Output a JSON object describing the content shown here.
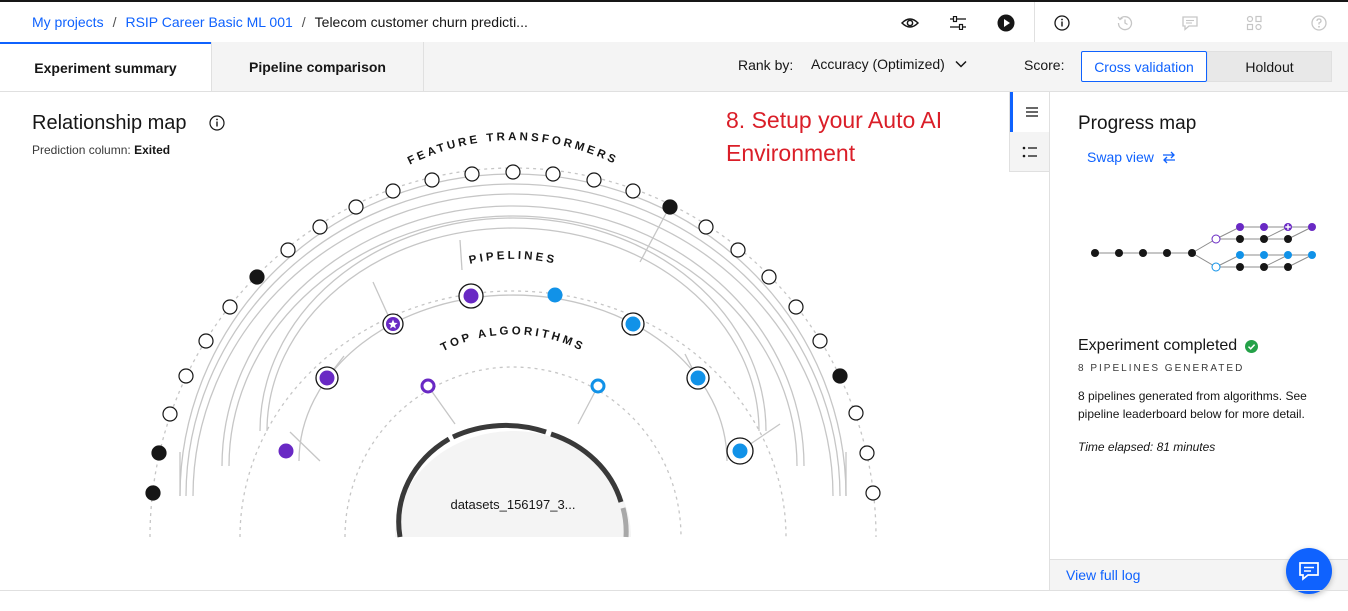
{
  "breadcrumb": {
    "items": [
      "My projects",
      "RSIP Career Basic ML 001"
    ],
    "current": "Telecom customer churn predicti...",
    "separator": "/"
  },
  "toolbar_icons": [
    "eye-icon",
    "sliders-icon",
    "play-icon",
    "info-icon",
    "history-icon",
    "comment-icon",
    "apps-icon",
    "help-icon"
  ],
  "tabs": [
    {
      "label": "Experiment summary",
      "active": true
    },
    {
      "label": "Pipeline comparison",
      "active": false
    }
  ],
  "rank": {
    "label": "Rank by:",
    "value": "Accuracy (Optimized)"
  },
  "score": {
    "label": "Score:",
    "options": [
      "Cross validation",
      "Holdout"
    ],
    "selected": "Cross validation"
  },
  "relationship_map": {
    "title": "Relationship map",
    "prediction_label": "Prediction column:",
    "prediction_value": "Exited",
    "ring_labels": {
      "outer": "FEATURE TRANSFORMERS",
      "middle": "PIPELINES",
      "inner": "TOP ALGORITHMS"
    },
    "dataset": "datasets_156197_3..."
  },
  "annotation": {
    "line1": "8. Setup your Auto AI",
    "line2": "Environment"
  },
  "progress_map": {
    "title": "Progress map",
    "swap_view": "Swap view",
    "status": "Experiment completed",
    "count_label": "8 PIPELINES GENERATED",
    "description": "8 pipelines generated from algorithms. See pipeline leaderboard below for more detail.",
    "elapsed": "Time elapsed: 81 minutes",
    "view_log": "View full log"
  },
  "colors": {
    "accent": "#0f62fe",
    "purple": "#6929c4",
    "cyan": "#1192e8",
    "success": "#24a148",
    "annotation": "#da1e28"
  }
}
